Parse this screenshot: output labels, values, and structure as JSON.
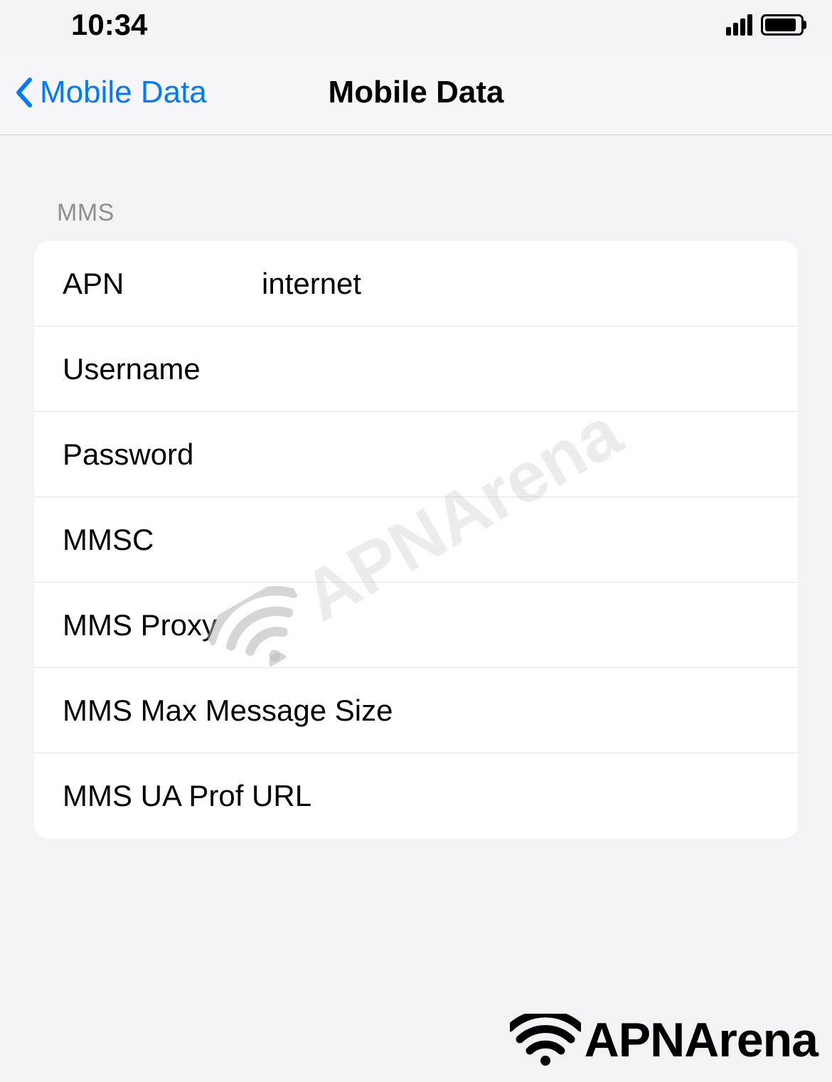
{
  "statusBar": {
    "time": "10:34"
  },
  "navBar": {
    "backLabel": "Mobile Data",
    "title": "Mobile Data"
  },
  "section": {
    "header": "MMS"
  },
  "fields": {
    "apn": {
      "label": "APN",
      "value": "internet"
    },
    "username": {
      "label": "Username",
      "value": ""
    },
    "password": {
      "label": "Password",
      "value": ""
    },
    "mmsc": {
      "label": "MMSC",
      "value": ""
    },
    "mmsProxy": {
      "label": "MMS Proxy",
      "value": ""
    },
    "mmsMaxSize": {
      "label": "MMS Max Message Size",
      "value": ""
    },
    "mmsUaProf": {
      "label": "MMS UA Prof URL",
      "value": ""
    }
  },
  "watermark": "APNArena",
  "logo": "APNArena"
}
